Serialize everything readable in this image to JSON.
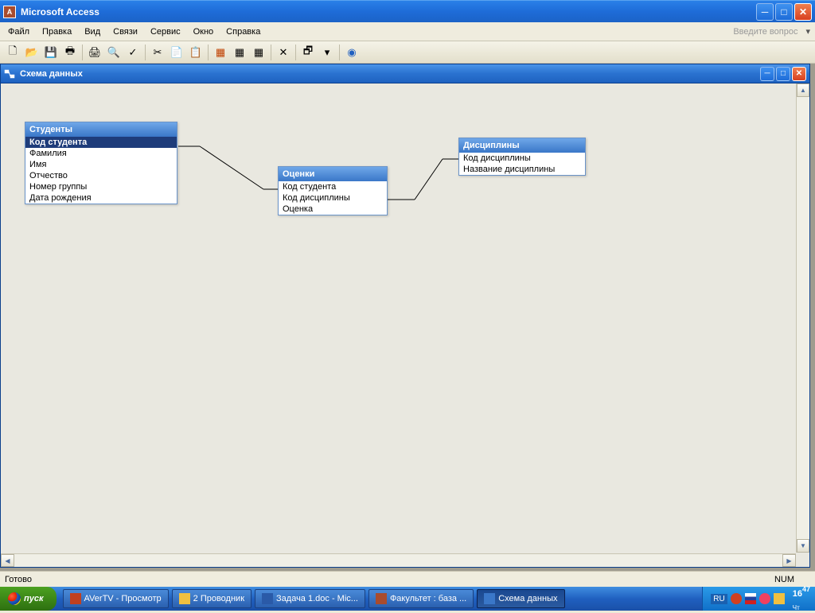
{
  "app": {
    "title": "Microsoft Access"
  },
  "menu": {
    "items": [
      "Файл",
      "Правка",
      "Вид",
      "Связи",
      "Сервис",
      "Окно",
      "Справка"
    ],
    "helpPlaceholder": "Введите вопрос"
  },
  "innerWindow": {
    "title": "Схема данных"
  },
  "tables": {
    "students": {
      "title": "Студенты",
      "fields": [
        "Код студента",
        "Фамилия",
        "Имя",
        "Отчество",
        "Номер группы",
        "Дата рождения"
      ]
    },
    "grades": {
      "title": "Оценки",
      "fields": [
        "Код студента",
        "Код дисциплины",
        "Оценка"
      ]
    },
    "subjects": {
      "title": "Дисциплины",
      "fields": [
        "Код дисциплины",
        "Название дисциплины"
      ]
    }
  },
  "status": {
    "ready": "Готово",
    "num": "NUM"
  },
  "taskbar": {
    "start": "пуск",
    "items": [
      {
        "label": "AVerTV - Просмотр",
        "icon": "tv"
      },
      {
        "label": "2 Проводник",
        "icon": "folder"
      },
      {
        "label": "Задача 1.doc - Mic...",
        "icon": "word"
      },
      {
        "label": "Факультет : база ...",
        "icon": "access"
      },
      {
        "label": "Схема данных",
        "icon": "rel"
      }
    ],
    "lang": "RU",
    "time": "16:47",
    "timeHour": "16",
    "timeMin": "47",
    "timeSub": "Чт"
  }
}
